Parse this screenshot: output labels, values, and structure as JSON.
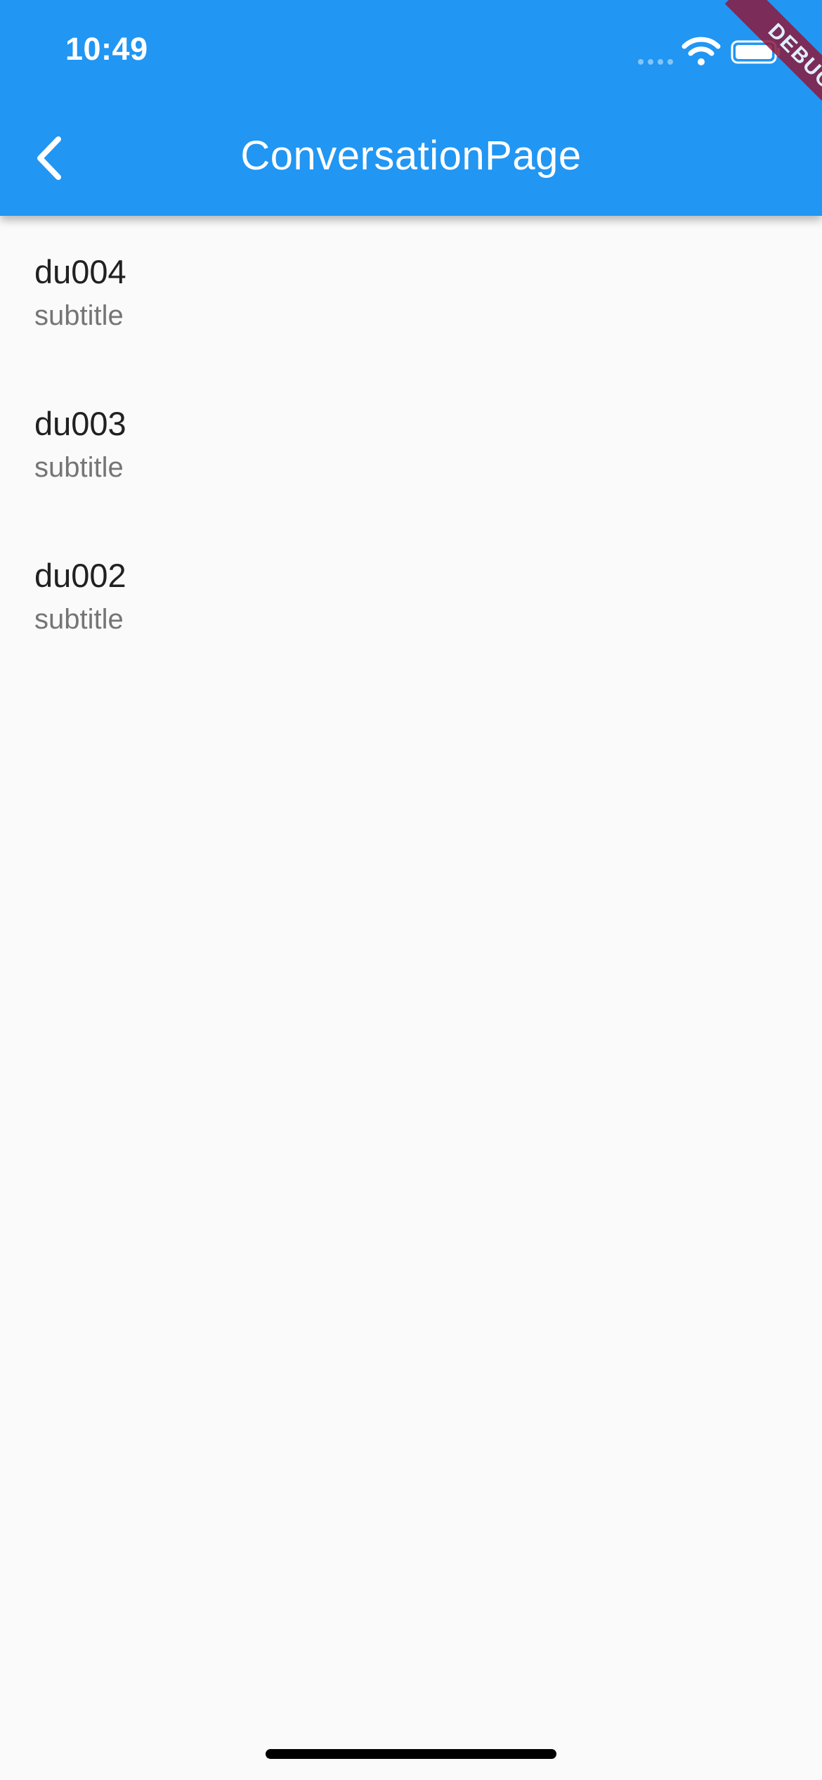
{
  "status_bar": {
    "time": "10:49"
  },
  "app_bar": {
    "title": "ConversationPage",
    "back_icon": "chevron-left-icon"
  },
  "debug_banner": {
    "label": "DEBUG"
  },
  "conversations": [
    {
      "title": "du004",
      "subtitle": "subtitle"
    },
    {
      "title": "du003",
      "subtitle": "subtitle"
    },
    {
      "title": "du002",
      "subtitle": "subtitle"
    }
  ],
  "colors": {
    "app_bar": "#2196f3",
    "background": "#fafafa",
    "title_text": "#212121",
    "subtitle_text": "#757575",
    "debug_ribbon": "#8b1a3e"
  }
}
